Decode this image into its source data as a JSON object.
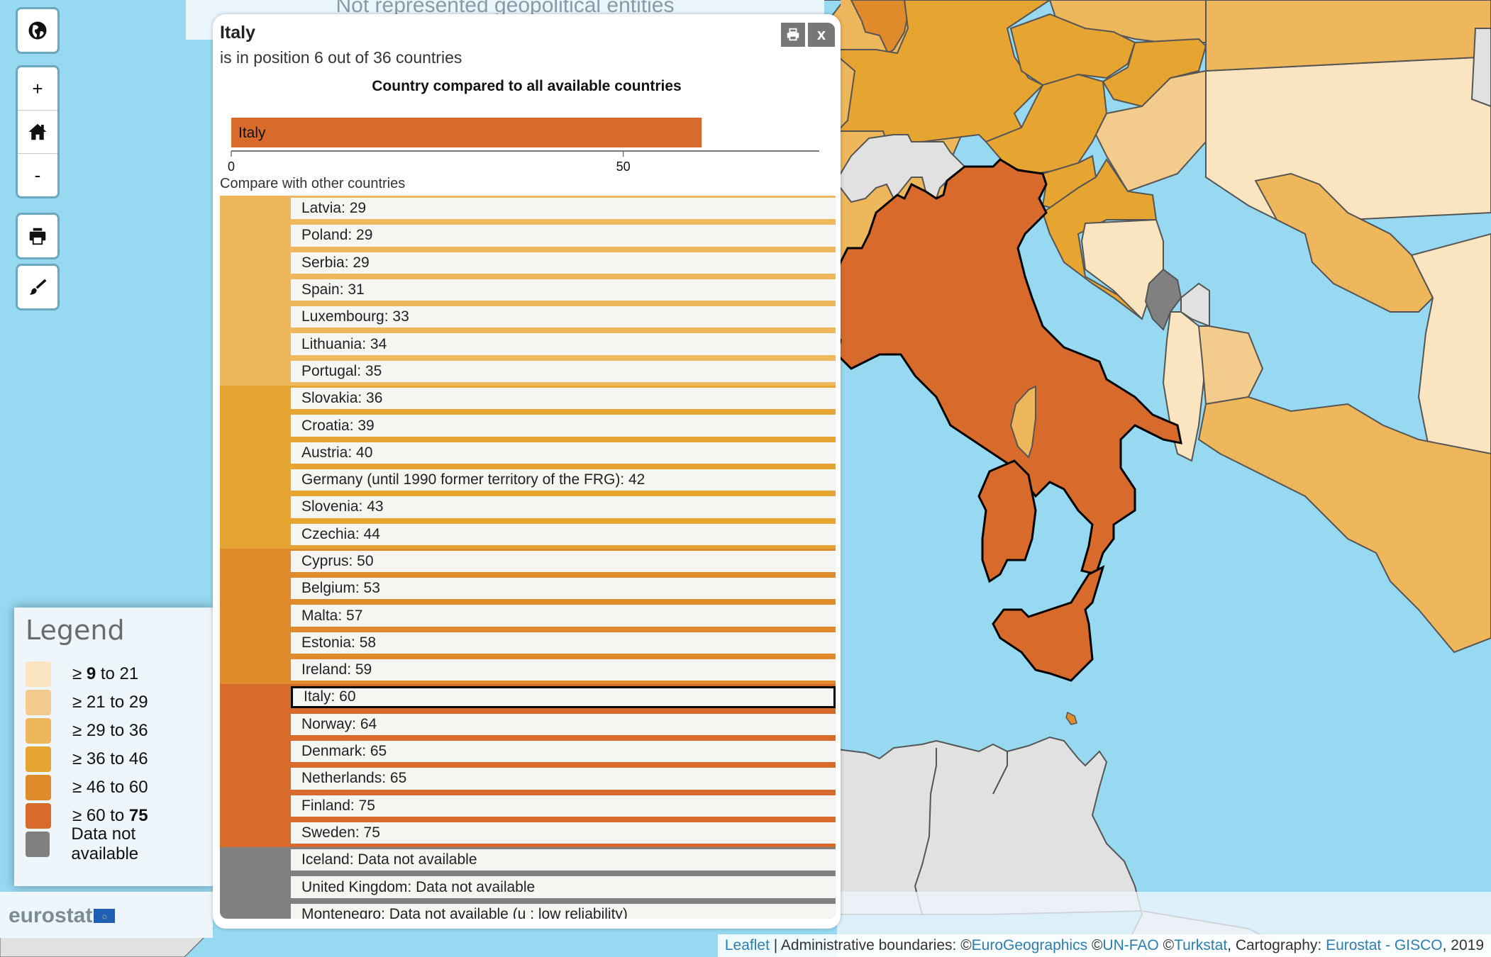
{
  "banner": {
    "text": "Not represented geopolitical entities"
  },
  "controls": {
    "globe": "globe-icon",
    "zoom_in": "+",
    "home": "home-icon",
    "zoom_out": "-",
    "print": "print-icon",
    "style": "paintbrush-icon"
  },
  "popup": {
    "country": "Italy",
    "position_text": "is in position 6 out of 36 countries",
    "print_button": "print-icon",
    "close_button": "x",
    "chart_title": "Country compared to all available countries",
    "compare_label": "Compare with other countries"
  },
  "chart_data": {
    "type": "bar",
    "title": "Country compared to all available countries",
    "categories": [
      "Italy"
    ],
    "values": [
      60
    ],
    "xlim": [
      0,
      75
    ],
    "xticks": [
      0,
      50
    ],
    "xtick_labels": [
      "0",
      "50"
    ],
    "bar_color": "#d86b2c"
  },
  "list": [
    {
      "label": "Latvia: 29",
      "class": 2
    },
    {
      "label": "Poland: 29",
      "class": 2
    },
    {
      "label": "Serbia: 29",
      "class": 2
    },
    {
      "label": "Spain: 31",
      "class": 2
    },
    {
      "label": "Luxembourg: 33",
      "class": 2
    },
    {
      "label": "Lithuania: 34",
      "class": 2
    },
    {
      "label": "Portugal: 35",
      "class": 2
    },
    {
      "label": "Slovakia: 36",
      "class": 3
    },
    {
      "label": "Croatia: 39",
      "class": 3
    },
    {
      "label": "Austria: 40",
      "class": 3
    },
    {
      "label": "Germany (until 1990 former territory of the FRG): 42",
      "class": 3
    },
    {
      "label": "Slovenia: 43",
      "class": 3
    },
    {
      "label": "Czechia: 44",
      "class": 3
    },
    {
      "label": "Cyprus: 50",
      "class": 4
    },
    {
      "label": "Belgium: 53",
      "class": 4
    },
    {
      "label": "Malta: 57",
      "class": 4
    },
    {
      "label": "Estonia: 58",
      "class": 4
    },
    {
      "label": "Ireland: 59",
      "class": 4
    },
    {
      "label": "Italy: 60",
      "class": 5,
      "selected": true
    },
    {
      "label": "Norway: 64",
      "class": 5
    },
    {
      "label": "Denmark: 65",
      "class": 5
    },
    {
      "label": "Netherlands: 65",
      "class": 5
    },
    {
      "label": "Finland: 75",
      "class": 5
    },
    {
      "label": "Sweden: 75",
      "class": 5
    },
    {
      "label": "Iceland: Data not available",
      "class": 6
    },
    {
      "label": "United Kingdom: Data not available",
      "class": 6
    },
    {
      "label": "Montenegro: Data not available (u : low reliability)",
      "class": 6
    }
  ],
  "legend": {
    "title": "Legend",
    "classes": [
      {
        "prefix": "≥ ",
        "bold_a": "9",
        "mid": " to 21",
        "bold_b": "",
        "color": "#fbe5c1"
      },
      {
        "prefix": "≥ ",
        "bold_a": "",
        "mid": "21 to 29",
        "bold_b": "",
        "color": "#f3cb8c"
      },
      {
        "prefix": "≥ ",
        "bold_a": "",
        "mid": "29 to 36",
        "bold_b": "",
        "color": "#eeb75c"
      },
      {
        "prefix": "≥ ",
        "bold_a": "",
        "mid": "36 to 46",
        "bold_b": "",
        "color": "#e6a431"
      },
      {
        "prefix": "≥ ",
        "bold_a": "",
        "mid": "46 to 60",
        "bold_b": "",
        "color": "#df8b2b"
      },
      {
        "prefix": "≥ ",
        "bold_a": "",
        "mid": "60 to ",
        "bold_b": "75",
        "color": "#d86b2c"
      },
      {
        "prefix": "",
        "bold_a": "",
        "mid": "Data not available",
        "bold_b": "",
        "color": "#808080"
      }
    ]
  },
  "logo": {
    "text": "eurostat"
  },
  "attribution": {
    "leaflet": "Leaflet",
    "sep": " | Administrative boundaries: ©",
    "eurogeo": "EuroGeographics",
    "c1": " ©",
    "unfao": "UN-FAO",
    "c2": " ©",
    "turkstat": "Turkstat",
    "c3": ", Cartography: ",
    "gisco": "Eurostat - GISCO",
    "year": ", 2019"
  },
  "map": {
    "colors": {
      "sea": "#96d9f1",
      "italy": "#d86b2c",
      "class_4": "#df8b2b",
      "class_3": "#e6a431",
      "class_2": "#eeb75c",
      "class_1": "#f3cb8c",
      "class_0": "#fbe5c1",
      "not_available": "#808080",
      "non_member": "#e1e1e1"
    }
  }
}
